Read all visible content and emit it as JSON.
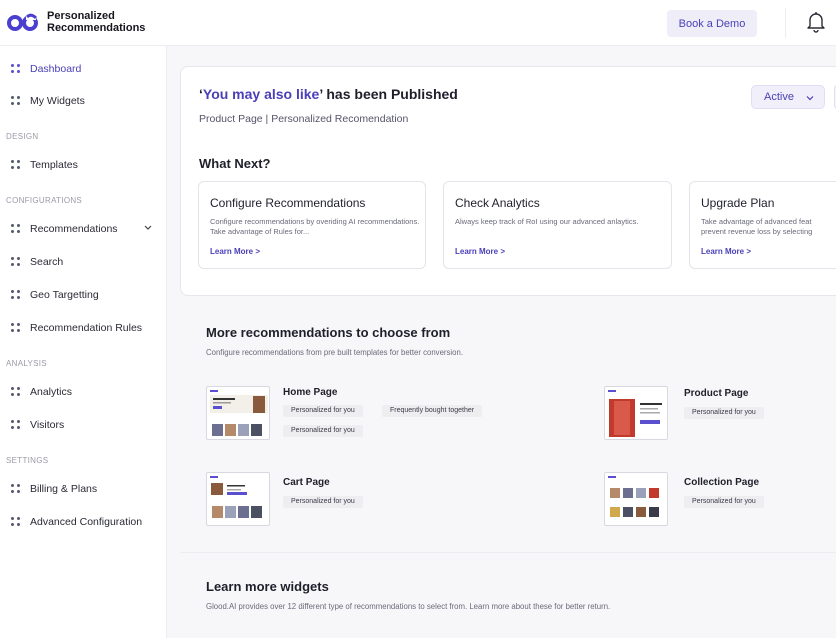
{
  "header": {
    "app_title_line1": "Personalized",
    "app_title_line2": "Recommendations",
    "demo_button": "Book a Demo"
  },
  "sidebar": {
    "items": [
      {
        "label": "Dashboard",
        "active": true
      },
      {
        "label": "My Widgets"
      },
      {
        "label": "Templates"
      },
      {
        "label": "Recommendations",
        "expandable": true
      },
      {
        "label": "Search"
      },
      {
        "label": "Geo Targetting"
      },
      {
        "label": "Recommendation Rules"
      },
      {
        "label": "Analytics"
      },
      {
        "label": "Visitors"
      },
      {
        "label": "Billing & Plans"
      },
      {
        "label": "Advanced Configuration"
      }
    ],
    "sections": [
      "DESIGN",
      "CONFIGURATIONS",
      "ANALYSIS",
      "SETTINGS"
    ]
  },
  "published": {
    "quote_open": "‘",
    "widget_name": "You may also like",
    "quote_close": "’",
    "suffix": " has been Published",
    "subtitle": "Product Page | Personalized Recomendation",
    "status": "Active"
  },
  "what_next": {
    "title": "What Next?",
    "cards": [
      {
        "title": "Configure Recommendations",
        "desc": "Configure recommendations by overiding AI recommendations. Take advantage of Rules for...",
        "link": "Learn More >"
      },
      {
        "title": "Check Analytics",
        "desc": "Always keep track of RoI using our advanced anlaytics.",
        "link": "Learn More >"
      },
      {
        "title": "Upgrade Plan",
        "desc": "Take advantage of advanced feat prevent revenue loss by selecting",
        "link": "Learn More >"
      }
    ]
  },
  "more": {
    "title": "More recommendations to choose from",
    "subtitle": "Configure recommendations from pre built templates for better conversion.",
    "templates": [
      {
        "name": "Home Page",
        "tags": [
          "Personalized for you",
          "Frequently bought together",
          "Personalized for you"
        ]
      },
      {
        "name": "Product Page",
        "tags": [
          "Personalized for you"
        ]
      },
      {
        "name": "Cart Page",
        "tags": [
          "Personalized for you"
        ]
      },
      {
        "name": "Collection Page",
        "tags": [
          "Personalized for you"
        ]
      }
    ]
  },
  "learn": {
    "title": "Learn more widgets",
    "desc": "Glood.AI provides over 12 different type of recommendations to select from. Learn more about these for better return."
  },
  "colors": {
    "accent": "#4a3fb8",
    "logo": "#4b3fd0"
  }
}
